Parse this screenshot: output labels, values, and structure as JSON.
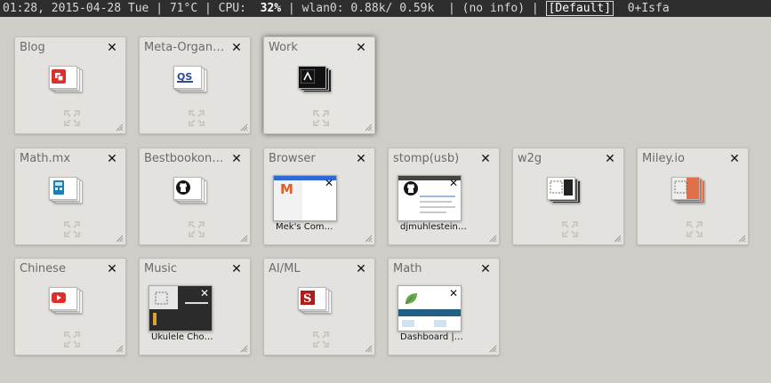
{
  "statusbar": {
    "datetime": "01:28, 2015-04-28 Tue",
    "temp": "71°C",
    "cpu_label": "CPU:",
    "cpu_value": "32%",
    "wlan_label": "wlan0:",
    "wlan_down": "0.88k/",
    "wlan_up": "0.59k",
    "info": "(no info)",
    "layout": "[Default]",
    "extra": "0+Isfa"
  },
  "groups": [
    {
      "title": "Blog",
      "icon": "pdf-icon"
    },
    {
      "title": "Meta-Organ…",
      "icon": "qs-icon"
    },
    {
      "title": "Work",
      "icon": "terminal-icon",
      "active": true
    },
    {
      "title": "Math.mx",
      "icon": "calculator-icon"
    },
    {
      "title": "Bestbookon…",
      "icon": "github-icon"
    },
    {
      "title": "Browser",
      "tab_label": "Mek's Com…",
      "icon": "m-logo-icon"
    },
    {
      "title": "stomp(usb)",
      "tab_label": "djmuhlestein…",
      "icon": "github-icon"
    },
    {
      "title": "w2g",
      "icon": "blank-page-icon"
    },
    {
      "title": "Miley.io",
      "icon": "blank-page-icon"
    },
    {
      "title": "Chinese",
      "icon": "youtube-icon"
    },
    {
      "title": "Music",
      "tab_label": "Ukulele Cho…",
      "icon": "blank-page-icon"
    },
    {
      "title": "AI/ML",
      "icon": "s-logo-icon"
    },
    {
      "title": "Math",
      "tab_label": "Dashboard |…",
      "icon": "leaf-icon"
    }
  ],
  "colors": {
    "background": "#cfcdc8",
    "group_bg": "#e4e2de",
    "statusbar_bg": "#2e2e2e"
  }
}
